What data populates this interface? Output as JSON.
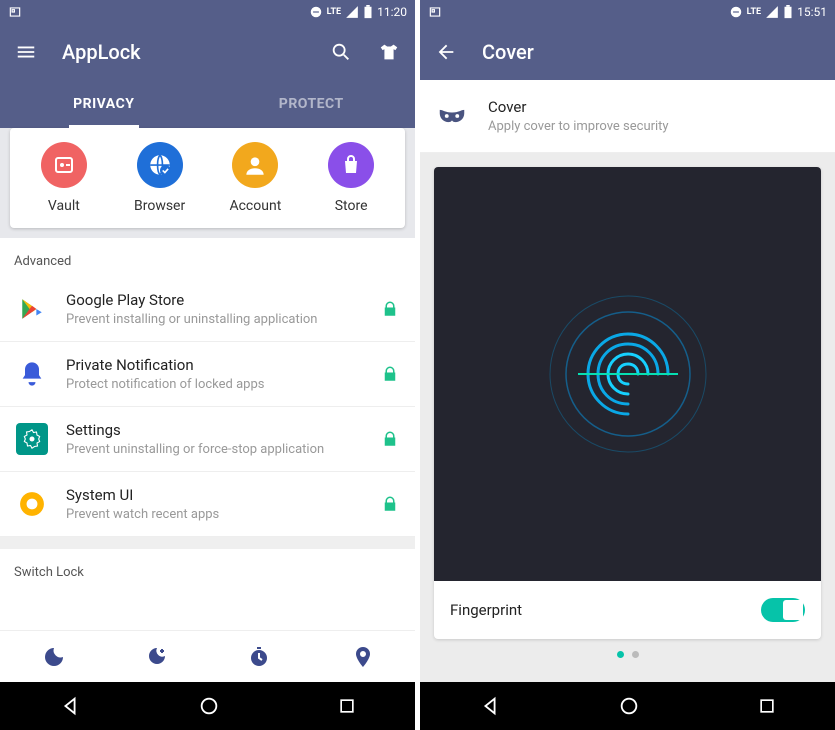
{
  "screens": {
    "left": {
      "statusbar": {
        "time": "11:20",
        "net": "LTE"
      },
      "appbar": {
        "title": "AppLock"
      },
      "tabs": {
        "privacy": "PRIVACY",
        "protect": "PROTECT"
      },
      "quick": {
        "vault": "Vault",
        "browser": "Browser",
        "account": "Account",
        "store": "Store"
      },
      "sections": {
        "advanced": "Advanced",
        "switchlock": "Switch Lock"
      },
      "rows": {
        "playstore": {
          "title": "Google Play Store",
          "sub": "Prevent installing or uninstalling application"
        },
        "privnotif": {
          "title": "Private Notification",
          "sub": "Protect notification of locked apps"
        },
        "settings": {
          "title": "Settings",
          "sub": "Prevent uninstalling or force-stop application"
        },
        "systemui": {
          "title": "System UI",
          "sub": "Prevent watch recent apps"
        }
      }
    },
    "right": {
      "statusbar": {
        "time": "15:51",
        "net": "LTE"
      },
      "appbar": {
        "title": "Cover"
      },
      "cover": {
        "title": "Cover",
        "sub": "Apply cover to improve security"
      },
      "fingerprint": {
        "label": "Fingerprint",
        "enabled": true
      }
    }
  },
  "colors": {
    "brand": "#555e89",
    "accent": "#06c3a9",
    "lock": "#1ec28b",
    "vault": "#f06363",
    "browser": "#1f6fd8",
    "account": "#f2a81d",
    "store": "#8a4fe9"
  }
}
